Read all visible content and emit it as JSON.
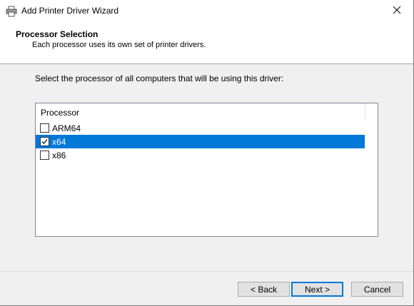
{
  "window": {
    "title": "Add Printer Driver Wizard"
  },
  "header": {
    "title": "Processor Selection",
    "subtitle": "Each processor uses its own set of printer drivers."
  },
  "instruction": "Select the processor of all computers that will be using this driver:",
  "list": {
    "column_header": "Processor",
    "items": [
      {
        "label": "ARM64",
        "checked": false,
        "selected": false
      },
      {
        "label": "x64",
        "checked": true,
        "selected": true
      },
      {
        "label": "x86",
        "checked": false,
        "selected": false
      }
    ]
  },
  "buttons": {
    "back": "< Back",
    "next": "Next >",
    "cancel": "Cancel"
  },
  "colors": {
    "selection": "#0078d7"
  }
}
